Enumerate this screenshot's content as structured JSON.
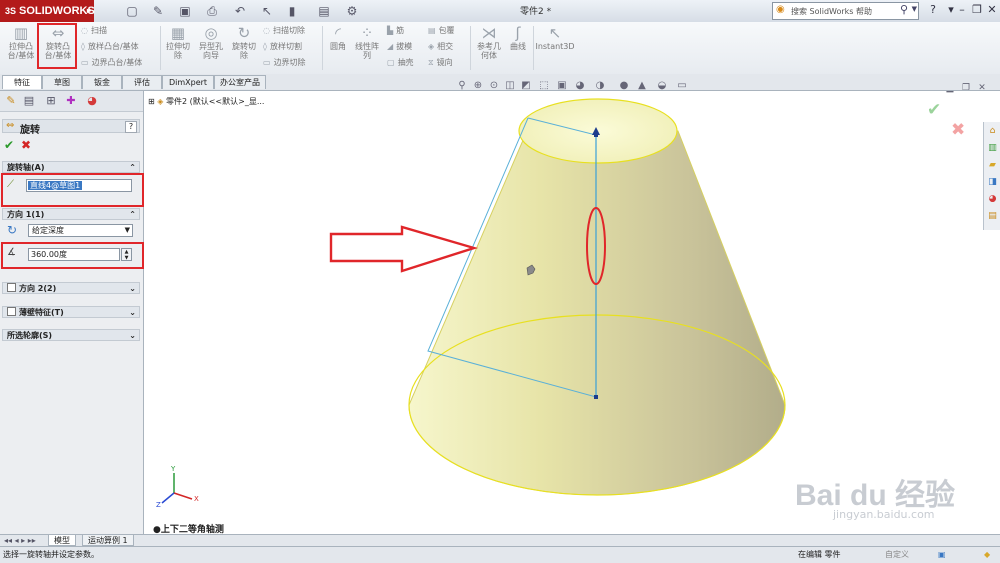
{
  "app": {
    "logo_prefix": "3S",
    "logo_text": "SOLIDWORKS",
    "doc_title": "零件2 *",
    "search_placeholder": "搜索 SolidWorks 帮助",
    "quick_access_icons": [
      "new-icon",
      "open-icon",
      "save-icon",
      "print-icon",
      "undo-icon",
      "select-icon",
      "rebuild-icon",
      "file-properties-icon",
      "options-icon"
    ],
    "window_icons": [
      "help-icon",
      "minimize-icon",
      "restore-icon",
      "close-icon"
    ]
  },
  "commands": {
    "extrude_boss": "拉伸凸\n台/基体",
    "revolve_boss": "旋转凸\n台/基体",
    "sweep": "扫描",
    "loft_boss": "放样凸台/基体",
    "boundary_boss": "边界凸台/基体",
    "extrude_cut": "拉伸切\n除",
    "hole_wizard": "异型孔\n向导",
    "revolve_cut": "旋转切\n除",
    "swept_cut": "扫描切除",
    "lofted_cut": "放样切割",
    "boundary_cut": "边界切除",
    "fillet": "圆角",
    "linear_pattern": "线性阵\n列",
    "rib": "筋",
    "draft": "拔模",
    "shell": "抽壳",
    "wrap": "包覆",
    "intersect": "相交",
    "mirror": "镜向",
    "ref_geometry": "参考几\n何体",
    "curves": "曲线",
    "instant3d": "Instant3D"
  },
  "tabs": [
    "特征",
    "草图",
    "钣金",
    "评估",
    "DimXpert",
    "办公室产品"
  ],
  "pm": {
    "title": "旋转",
    "help": "?",
    "ok": "✔",
    "cancel": "✖",
    "axis_group": "旋转轴(A)",
    "axis_value": "直线4@草图1",
    "dir1_group": "方向 1(1)",
    "end_condition": "给定深度",
    "angle": "360.00度",
    "dir2_group": "方向 2(2)",
    "thin_group": "薄壁特征(T)",
    "contours_group": "所选轮廓(S)"
  },
  "tree": {
    "expander": "⊞",
    "label": "零件2 (默认<<默认>_显..."
  },
  "view": {
    "orientation": "●上下二等角轴测"
  },
  "bottom_tabs": [
    "模型",
    "运动算例 1"
  ],
  "status": {
    "message": "选择一旋转轴并设定参数。",
    "editing": "在编辑 零件",
    "custom": "自定义"
  },
  "watermark": {
    "brand": "Bai du 经验",
    "url": "jingyan.baidu.com"
  },
  "colors": {
    "accent_red": "#e0262a",
    "cone_yellow": "#e9e9a0",
    "axis_blue": "#3aa0d8",
    "selection_blue": "#3a78c3"
  }
}
